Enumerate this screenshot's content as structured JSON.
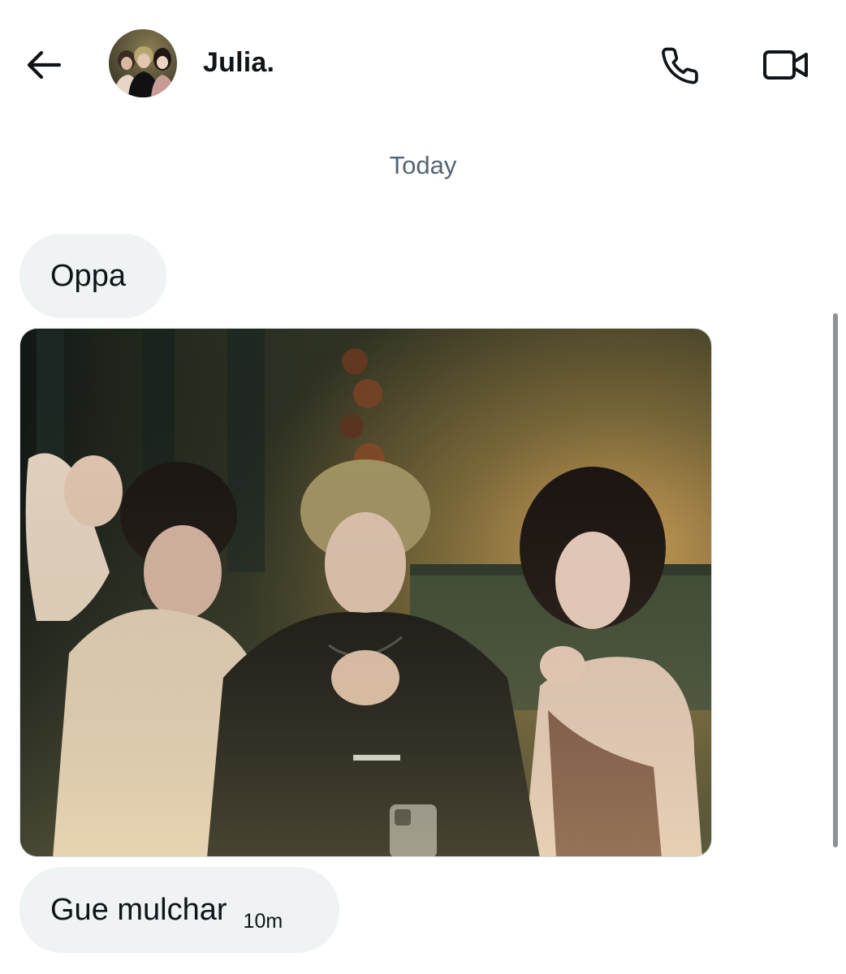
{
  "header": {
    "contact_name": "Julia.",
    "icons": {
      "back": "back-arrow-icon",
      "call": "phone-icon",
      "video": "video-camera-icon"
    }
  },
  "conversation": {
    "date_separator": "Today",
    "messages": [
      {
        "type": "text",
        "text": "Oppa"
      },
      {
        "type": "image",
        "content": "group-photo"
      },
      {
        "type": "text",
        "text": "Gue mulchar",
        "timestamp": "10m"
      }
    ]
  },
  "colors": {
    "bubble_bg": "#eff3f4",
    "secondary_text": "#536471",
    "primary_text": "#0f1419"
  }
}
